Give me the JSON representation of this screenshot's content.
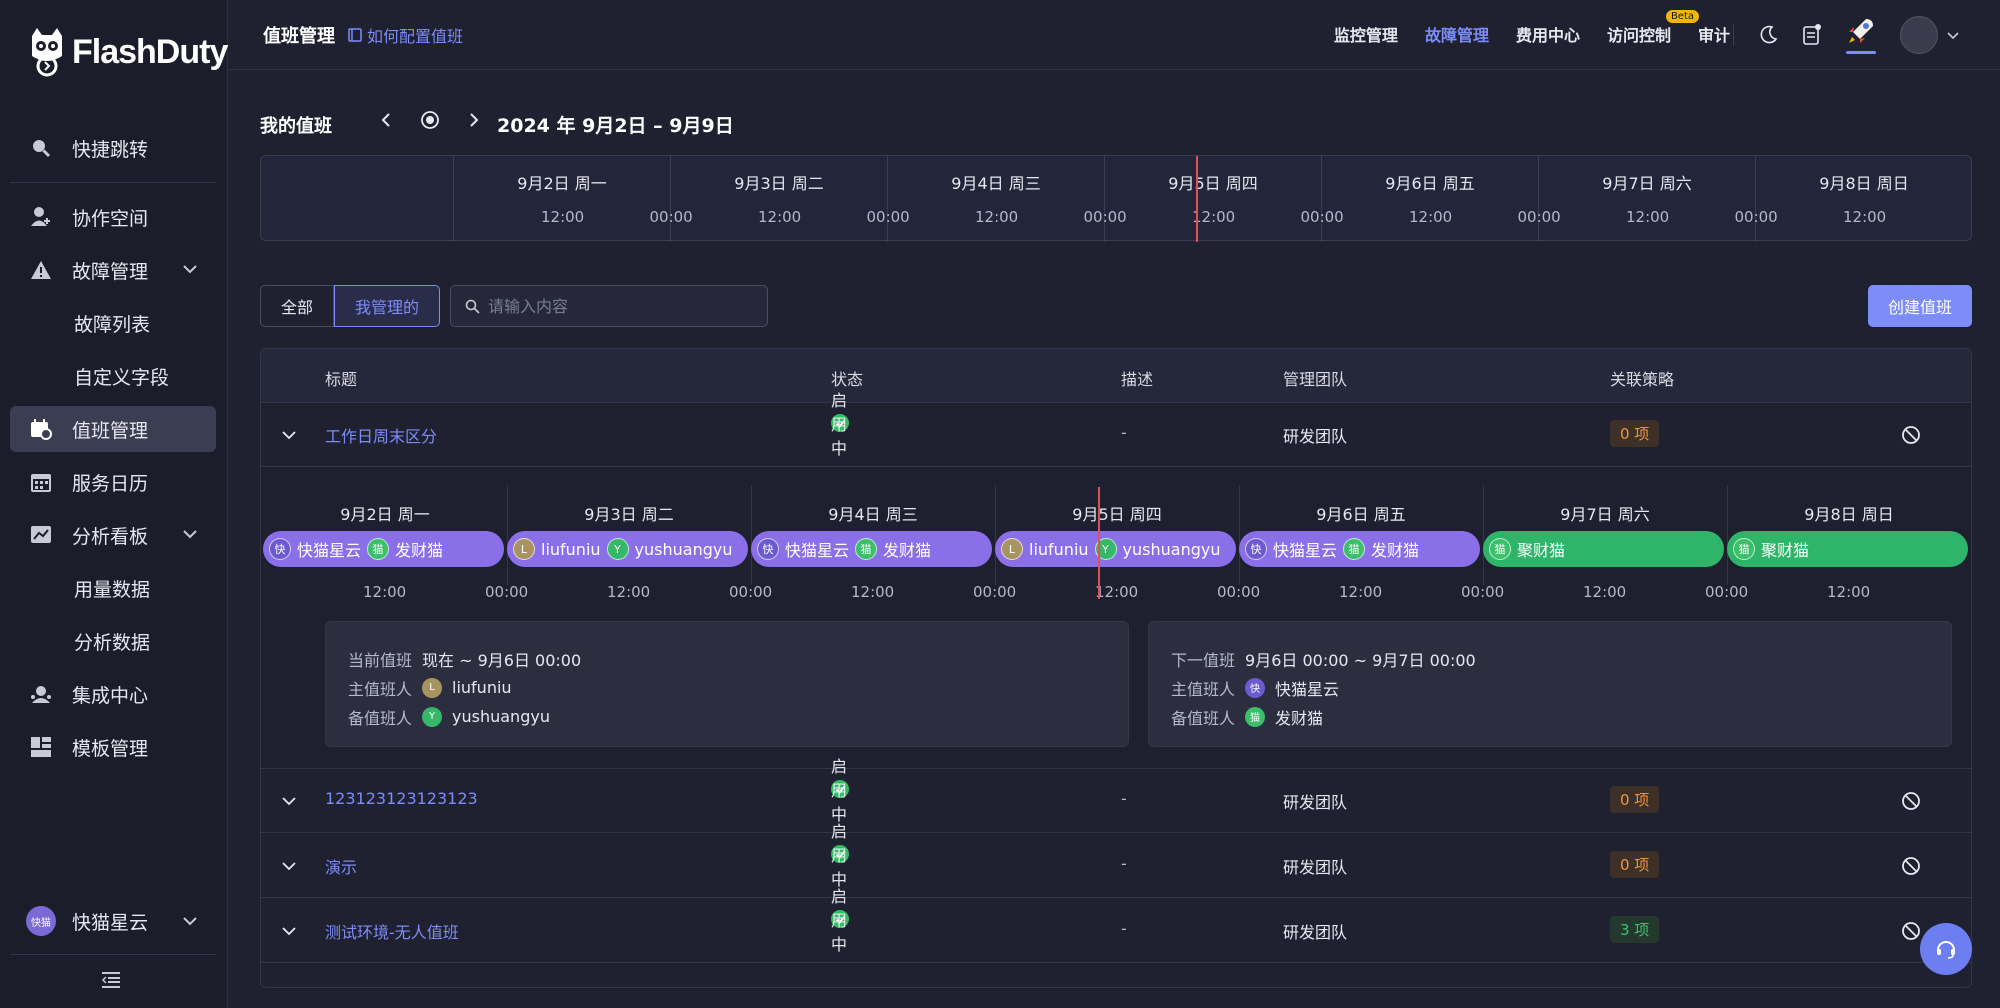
{
  "brand": {
    "name": "FlashDuty"
  },
  "sidebar": {
    "items": [
      {
        "label": "快捷跳转",
        "icon": "search-icon"
      },
      {
        "label": "协作空间",
        "icon": "user-add-icon"
      },
      {
        "label": "故障管理",
        "icon": "warning-icon"
      },
      {
        "label": "故障列表"
      },
      {
        "label": "自定义字段"
      },
      {
        "label": "值班管理",
        "icon": "calendar-clock-icon"
      },
      {
        "label": "服务日历",
        "icon": "calendar-icon"
      },
      {
        "label": "分析看板",
        "icon": "chart-icon"
      },
      {
        "label": "用量数据"
      },
      {
        "label": "分析数据"
      },
      {
        "label": "集成中心",
        "icon": "integration-icon"
      },
      {
        "label": "模板管理",
        "icon": "template-icon"
      }
    ],
    "user": {
      "avatar_text": "快猫",
      "name": "快猫星云"
    }
  },
  "header": {
    "title": "值班管理",
    "help_link": "如何配置值班",
    "nav": [
      "监控管理",
      "故障管理",
      "费用中心",
      "访问控制",
      "审计"
    ],
    "beta": "Beta"
  },
  "my_duty": {
    "label": "我的值班",
    "range": "2024 年 9月2日 – 9月9日",
    "days": [
      "9月2日 周一",
      "9月3日 周二",
      "9月4日 周三",
      "9月5日 周四",
      "9月6日 周五",
      "9月7日 周六",
      "9月8日 周日"
    ],
    "times": [
      "12:00",
      "00:00",
      "12:00",
      "00:00",
      "12:00",
      "00:00",
      "12:00",
      "00:00",
      "12:00",
      "00:00",
      "12:00",
      "00:00",
      "12:00"
    ]
  },
  "filters": {
    "all": "全部",
    "mine": "我管理的",
    "search_placeholder": "请输入内容",
    "create": "创建值班"
  },
  "table": {
    "headers": [
      "标题",
      "状态",
      "描述",
      "管理团队",
      "关联策略"
    ],
    "rows": [
      {
        "title": "工作日周末区分",
        "status": "启用中",
        "desc": "-",
        "team": "研发团队",
        "policy": "0 项"
      },
      {
        "title": "123123123123123",
        "status": "启用中",
        "desc": "-",
        "team": "研发团队",
        "policy": "0 项"
      },
      {
        "title": "演示",
        "status": "启用中",
        "desc": "-",
        "team": "研发团队",
        "policy": "0 项"
      },
      {
        "title": "测试环境-无人值班",
        "status": "启用中",
        "desc": "-",
        "team": "研发团队",
        "policy": "3 项"
      }
    ]
  },
  "timeline": {
    "days": [
      "9月2日 周一",
      "9月3日 周二",
      "9月4日 周三",
      "9月5日 周四",
      "9月6日 周五",
      "9月7日 周六",
      "9月8日 周日"
    ],
    "pills": [
      {
        "a_chip": "快",
        "a": "快猫星云",
        "b_chip": "猫",
        "b": "发财猫",
        "color": "purple"
      },
      {
        "a_chip": "L",
        "a": "liufuniu",
        "b_chip": "Y",
        "b": "yushuangyu",
        "color": "purple"
      },
      {
        "a_chip": "快",
        "a": "快猫星云",
        "b_chip": "猫",
        "b": "发财猫",
        "color": "purple"
      },
      {
        "a_chip": "L",
        "a": "liufuniu",
        "b_chip": "Y",
        "b": "yushuangyu",
        "color": "purple"
      },
      {
        "a_chip": "快",
        "a": "快猫星云",
        "b_chip": "猫",
        "b": "发财猫",
        "color": "purple"
      },
      {
        "a_chip": "猫",
        "a": "聚财猫",
        "color": "green"
      },
      {
        "a_chip": "猫",
        "a": "聚财猫",
        "color": "green"
      }
    ],
    "times": [
      "12:00",
      "00:00",
      "12:00",
      "00:00",
      "12:00",
      "00:00",
      "12:00",
      "00:00",
      "12:00",
      "00:00",
      "12:00",
      "00:00",
      "12:00"
    ],
    "current": {
      "k1": "当前值班",
      "v1": "现在 ~ 9月6日 00:00",
      "k2": "主值班人",
      "v2": "liufuniu",
      "c2": "L",
      "k3": "备值班人",
      "v3": "yushuangyu",
      "c3": "Y"
    },
    "next": {
      "k1": "下一值班",
      "v1": "9月6日 00:00 ~ 9月7日 00:00",
      "k2": "主值班人",
      "v2": "快猫星云",
      "c2": "快",
      "k3": "备值班人",
      "v3": "发财猫",
      "c3": "猫"
    }
  },
  "colors": {
    "accent": "#7c8cf8",
    "ok": "#2fbf62",
    "warn": "#f0963a",
    "now_line": "#e0505a"
  }
}
